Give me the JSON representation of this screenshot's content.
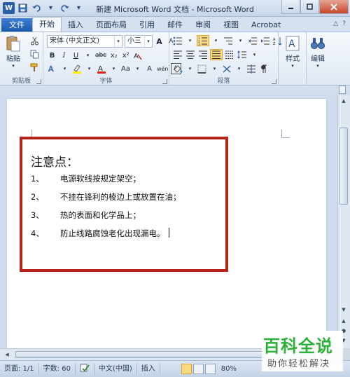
{
  "window": {
    "title": "新建 Microsoft Word 文档 - Microsoft Word",
    "app_icon_letter": "W"
  },
  "tabs": [
    {
      "label": "文件"
    },
    {
      "label": "开始"
    },
    {
      "label": "插入"
    },
    {
      "label": "页面布局"
    },
    {
      "label": "引用"
    },
    {
      "label": "邮件"
    },
    {
      "label": "审阅"
    },
    {
      "label": "视图"
    },
    {
      "label": "Acrobat"
    }
  ],
  "ribbon": {
    "clipboard": {
      "label": "剪贴板",
      "paste": "粘贴"
    },
    "font": {
      "label": "字体",
      "font_name": "宋体 (中文正文)",
      "font_size": "小三",
      "bold": "B",
      "italic": "I",
      "underline": "U",
      "strike": "abc",
      "subscript": "x₂",
      "superscript": "x²",
      "change_case": "Aa",
      "clear": "A",
      "grow": "A",
      "shrink": "A",
      "phonetic": "wén",
      "border": "A"
    },
    "paragraph": {
      "label": "段落"
    },
    "styles": {
      "label": "样式"
    },
    "editing": {
      "label": "编辑"
    }
  },
  "document": {
    "heading": "注意点：",
    "items": [
      {
        "num": "1、",
        "text": "电源软线按规定架空；"
      },
      {
        "num": "2、",
        "text": "不挂在锋利的棱边上或放置在油；"
      },
      {
        "num": "3、",
        "text": "热的表面和化学品上；"
      },
      {
        "num": "4、",
        "text": "防止线路腐蚀老化出现漏电。"
      }
    ]
  },
  "status": {
    "page": "页面: 1/1",
    "words": "字数: 60",
    "language": "中文(中国)",
    "mode": "插入",
    "zoom": "80%"
  },
  "watermark": {
    "main": "百科全说",
    "sub": "助你轻松解决"
  },
  "colors": {
    "highlight_box": "#b6241a",
    "file_tab": "#2a63b3",
    "watermark": "#2db03a"
  }
}
